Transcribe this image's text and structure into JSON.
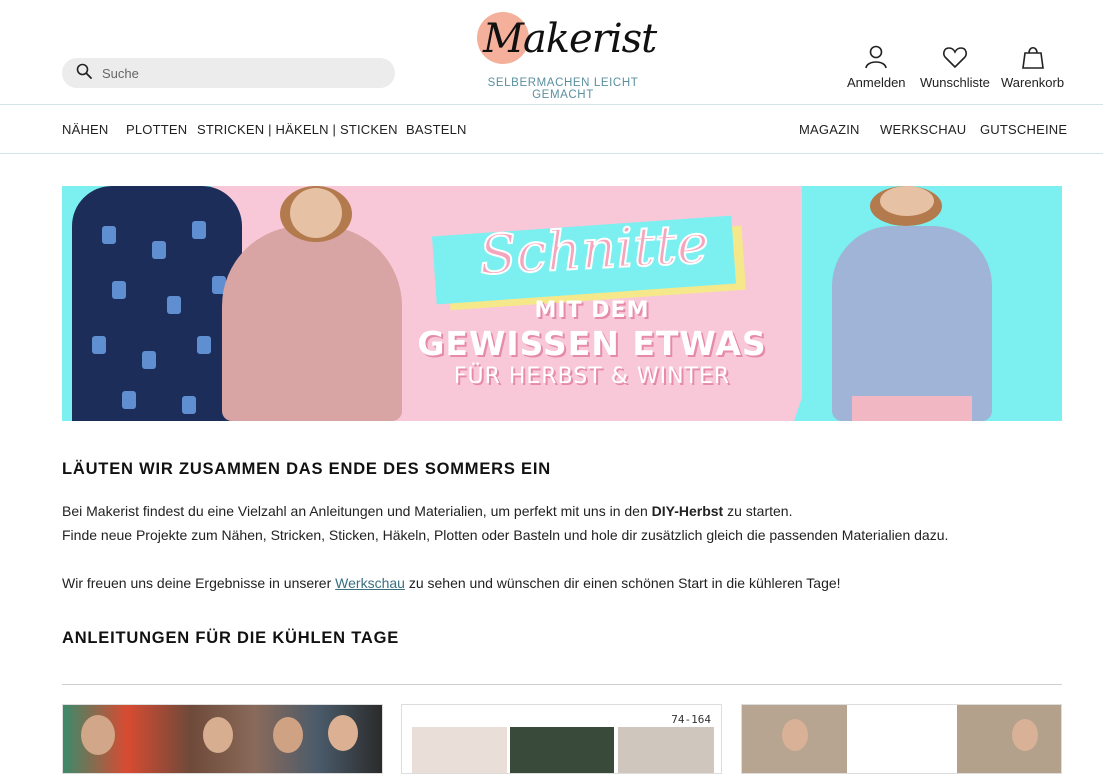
{
  "search": {
    "placeholder": "Suche"
  },
  "logo": {
    "wordmark": "Makerist",
    "tagline": "SELBERMACHEN LEICHT GEMACHT"
  },
  "account": {
    "login": "Anmelden",
    "wishlist": "Wunschliste",
    "cart": "Warenkorb"
  },
  "nav": {
    "left": [
      "NÄHEN",
      "PLOTTEN",
      "STRICKEN | HÄKELN | STICKEN",
      "BASTELN"
    ],
    "right": [
      "MAGAZIN",
      "WERKSCHAU",
      "GUTSCHEINE"
    ]
  },
  "banner": {
    "script": "Schnitte",
    "line1": "MIT DEM",
    "line2": "GEWISSEN ETWAS",
    "line3": "FÜR HERBST & WINTER",
    "colors": {
      "pink": "#f9c8d8",
      "cyan": "#7cf0f0",
      "yellow": "#f5e88a"
    }
  },
  "intro": {
    "heading": "LÄUTEN WIR ZUSAMMEN DAS ENDE DES SOMMERS EIN",
    "p1_before": "Bei Makerist findest du eine Vielzahl an Anleitungen und Materialien, um perfekt mit uns in den ",
    "p1_bold": "DIY-Herbst",
    "p1_after": " zu starten.",
    "p2": "Finde neue Projekte zum Nähen, Stricken, Sticken, Häkeln, Plotten oder Basteln und hole dir zusätzlich gleich die passenden Materialien dazu.",
    "p3_before": "Wir freuen uns deine Ergebnisse in unserer ",
    "p3_link": "Werkschau",
    "p3_after": " zu sehen und wünschen dir einen schönen Start in die kühleren Tage!"
  },
  "section2": {
    "heading": "ANLEITUNGEN FÜR DIE KÜHLEN TAGE"
  },
  "cards": {
    "size_label": "74-164"
  },
  "theme": {
    "accent": "#5a8fa0",
    "link": "#3a6f80",
    "logo_circle": "#f4b09a"
  }
}
